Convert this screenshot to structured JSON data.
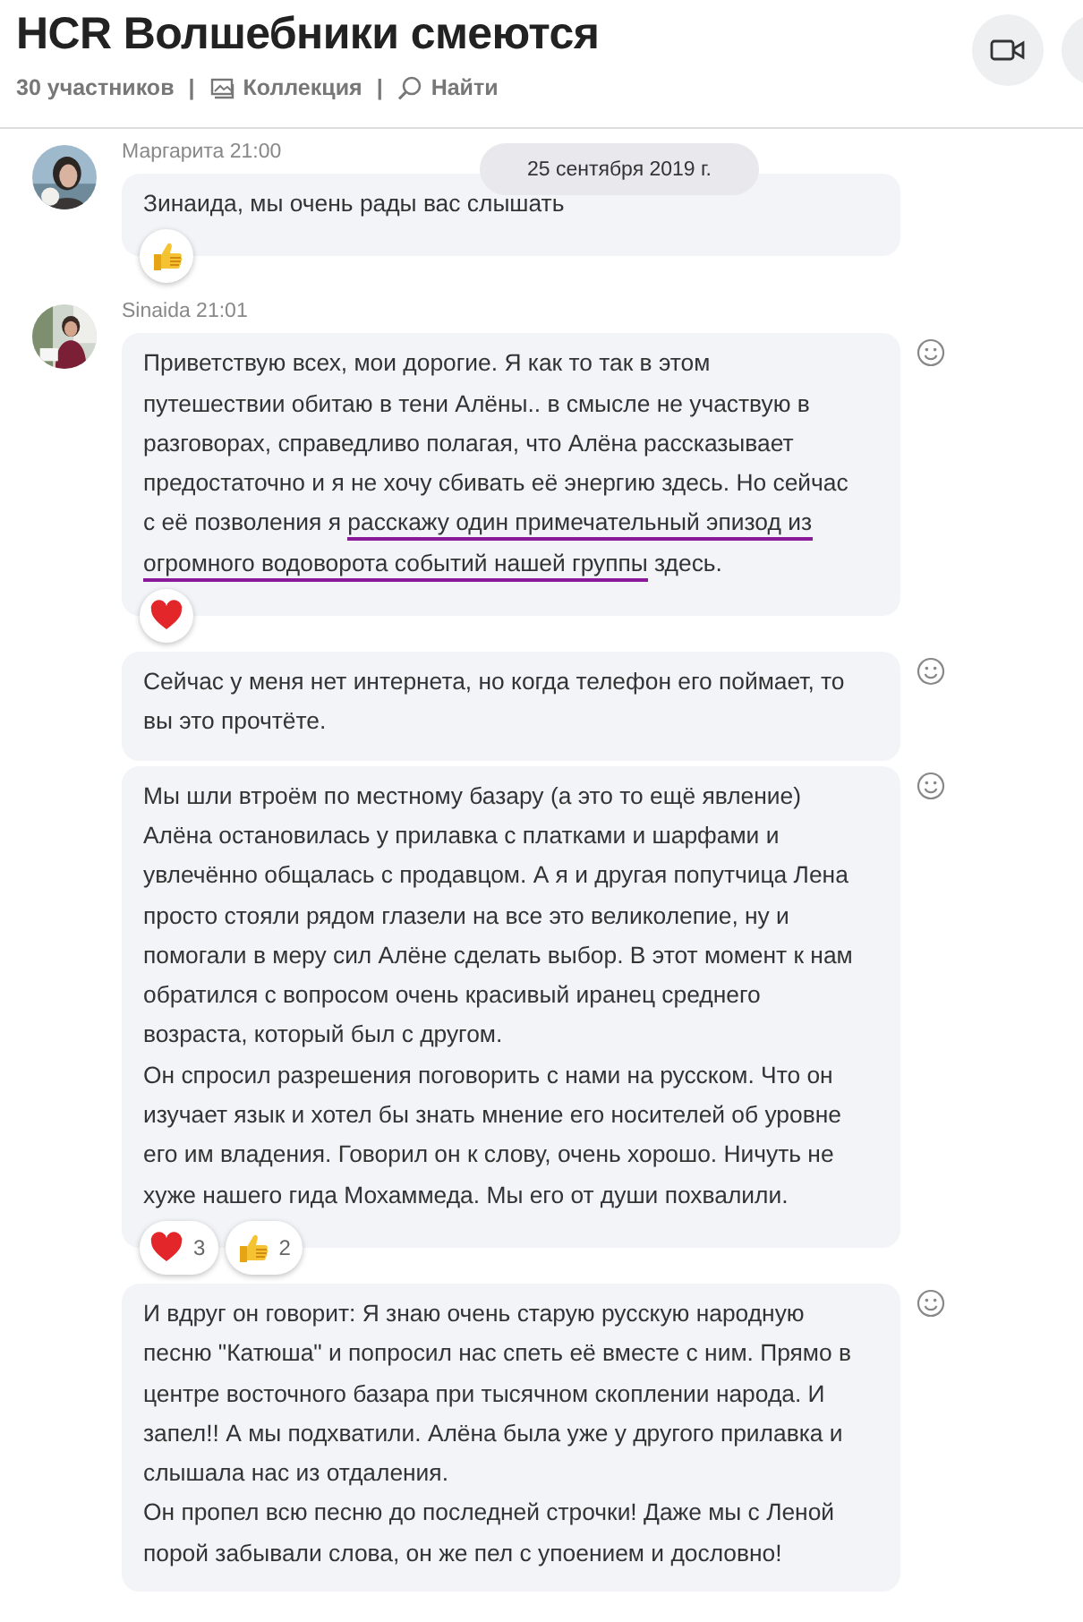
{
  "header": {
    "title": "HCR Волшебники смеются",
    "participants": "30 участников",
    "separator": "|",
    "links": [
      {
        "kind": "gallery",
        "label": "Коллекция"
      },
      {
        "kind": "search",
        "label": "Найти"
      }
    ],
    "buttons": [
      {
        "kind": "video"
      },
      {
        "kind": "circle"
      }
    ]
  },
  "date_pill": "25 сентября 2019 г.",
  "groups": [
    {
      "sender": "Маргарита",
      "time": "21:00",
      "messages": [
        {
          "parts": [
            {
              "text": "Зинаида, мы очень рады вас слышать",
              "underlined": false
            }
          ],
          "smiley": false,
          "reactions": [
            {
              "kind": "thumbs_up"
            }
          ]
        }
      ]
    },
    {
      "sender": "Sinaida",
      "time": "21:01",
      "messages": [
        {
          "parts": [
            {
              "text": "Приветствую всех, мои дорогие. Я как то так в этом путешествии обитаю в тени Алёны.. в смысле не участвую в разговорах, справедливо полагая, что Алёна рассказывает предостаточно и я не хочу сбивать её энергию здесь. Но сейчас с её позволения я ",
              "underlined": false
            },
            {
              "text": "расскажу один примечательный эпизод из огромного водоворота событий нашей группы",
              "underlined": true
            },
            {
              "text": " здесь.",
              "underlined": false
            }
          ],
          "smiley": true,
          "reactions": [
            {
              "kind": "heart"
            }
          ]
        },
        {
          "parts": [
            {
              "text": "Сейчас у меня нет интернета, но когда телефон его поймает, то вы это прочтёте.",
              "underlined": false
            }
          ],
          "smiley": true
        },
        {
          "parts": [
            {
              "text": "Мы шли втроём по местному базару (а это то ещё явление) Алёна остановилась у прилавка с платками и шарфами и увлечённо общалась с продавцом. А я и другая попутчица Лена просто стояли рядом глазели на все это великолепие, ну и помогали в меру сил Алёне сделать выбор. В этот момент к нам обратился с вопросом очень красивый иранец среднего возраста, который был с другом.\nОн спросил разрешения поговорить с нами на русском. Что он изучает язык и хотел бы знать мнение его носителей об уровне его им владения. Говорил он к слову, очень хорошо. Ничуть не хуже нашего гида Мохаммеда. Мы его от души похвалили.",
              "underlined": false
            }
          ],
          "smiley": true,
          "reactions": [
            {
              "kind": "heart",
              "count": "3"
            },
            {
              "kind": "thumbs_up",
              "count": "2"
            }
          ]
        },
        {
          "parts": [
            {
              "text": "И вдруг он говорит: Я знаю очень старую русскую народную песню \"Катюша\" и попросил нас спеть её вместе с ним. Прямо в центре восточного базара при тысячном скоплении народа. И запел!! А мы подхватили. Алёна была уже у другого прилавка и слышала нас из отдаления.\nОн пропел всю песню до последней строчки! Даже мы с Леной порой забывали слова, он же пел с упоением и дословно!",
              "underlined": false
            }
          ],
          "smiley": true
        }
      ]
    }
  ]
}
